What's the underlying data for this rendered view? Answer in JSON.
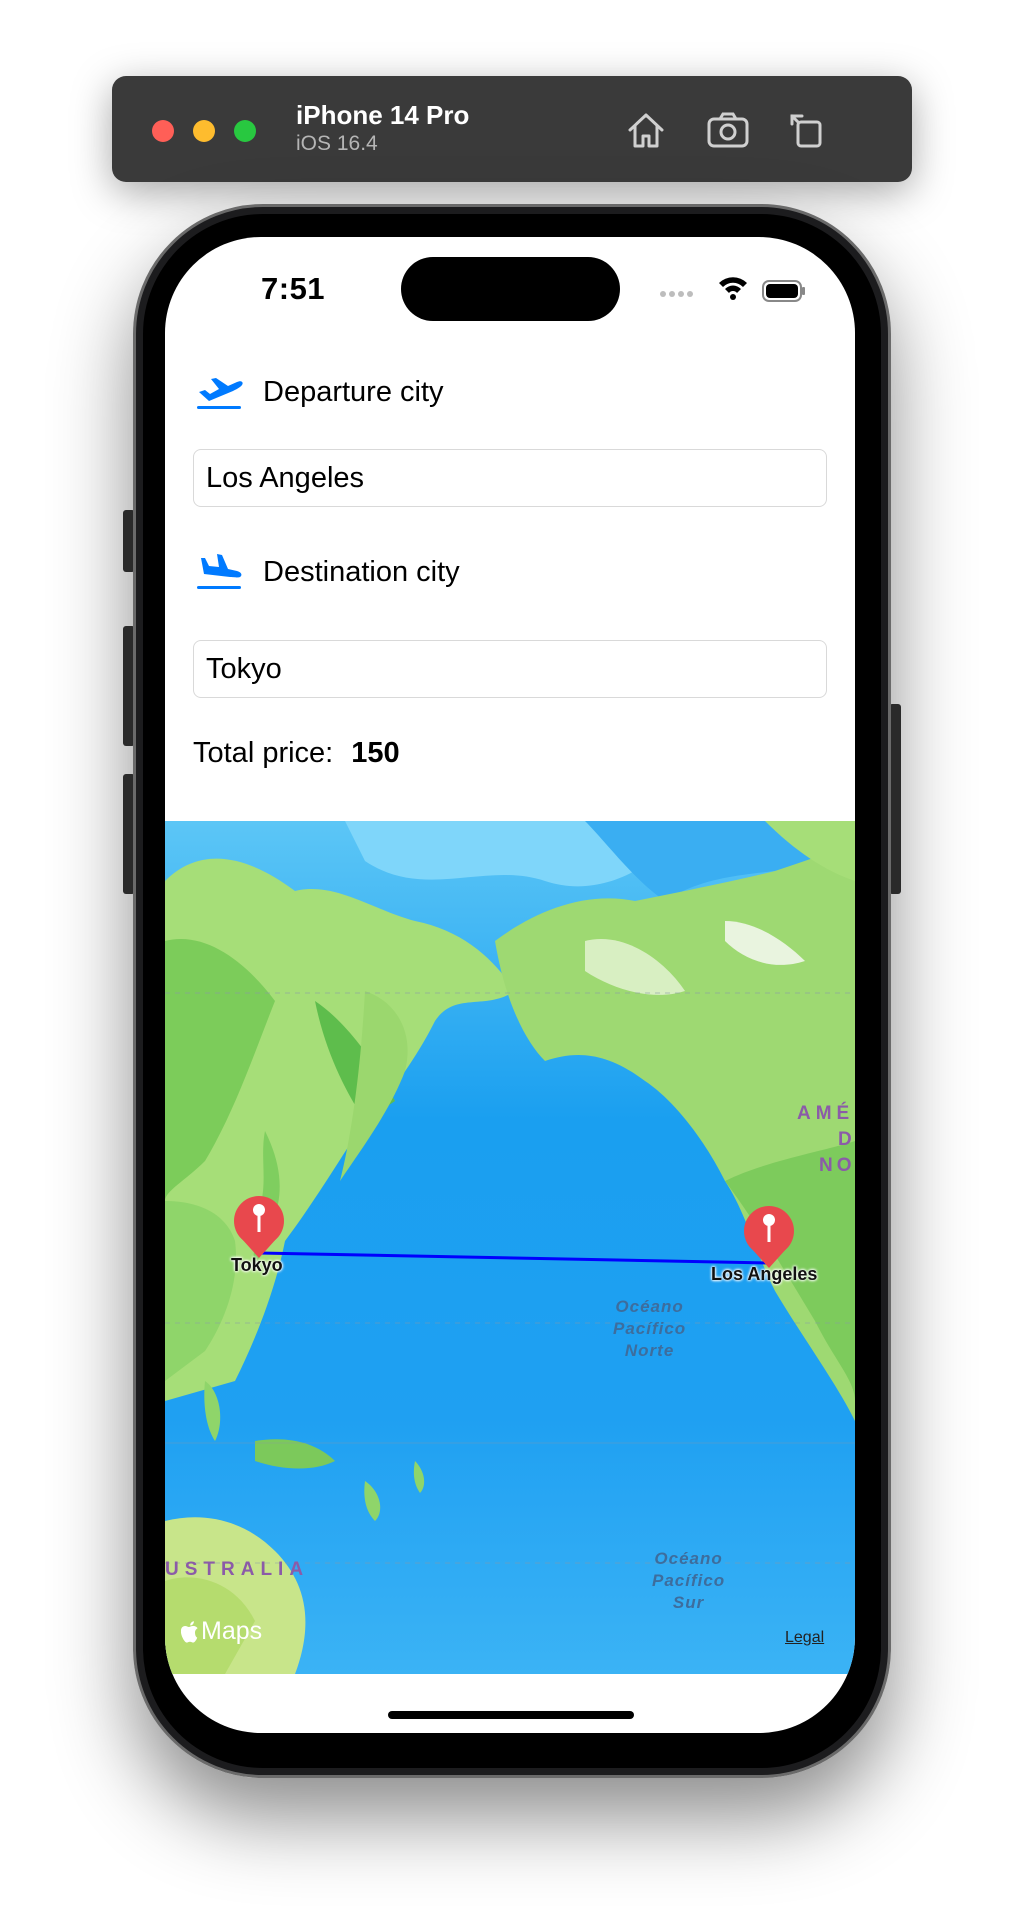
{
  "simulator": {
    "device_name": "iPhone 14 Pro",
    "os_version": "iOS 16.4",
    "toolbar_icons": [
      "home-icon",
      "screenshot-icon",
      "rotate-icon"
    ]
  },
  "status_bar": {
    "time": "7:51",
    "icons": [
      "signal-icon",
      "wifi-icon",
      "battery-icon"
    ]
  },
  "form": {
    "departure_label": "Departure city",
    "departure_value": "Los Angeles",
    "departure_icon": "airplane-departure-icon",
    "destination_label": "Destination city",
    "destination_value": "Tokyo",
    "destination_icon": "airplane-arrival-icon",
    "price_label": "Total price:",
    "price_value": "150"
  },
  "map": {
    "origin_label": "Los Angeles",
    "destination_label": "Tokyo",
    "route_color": "#0000ff",
    "pin_color": "#e8484d",
    "ocean_labels": {
      "north_pacific": [
        "Océano",
        "Pacífico",
        "Norte"
      ],
      "south_pacific": [
        "Océano",
        "Pacífico",
        "Sur"
      ]
    },
    "region_labels": {
      "australia": "USTRALIA",
      "america_line1": "AMÉ",
      "america_line2": "D",
      "america_line3": "NO"
    },
    "attribution": "Maps",
    "legal": "Legal"
  },
  "colors": {
    "accent": "#007aff",
    "toolbar_bg": "#3a3a3a"
  }
}
